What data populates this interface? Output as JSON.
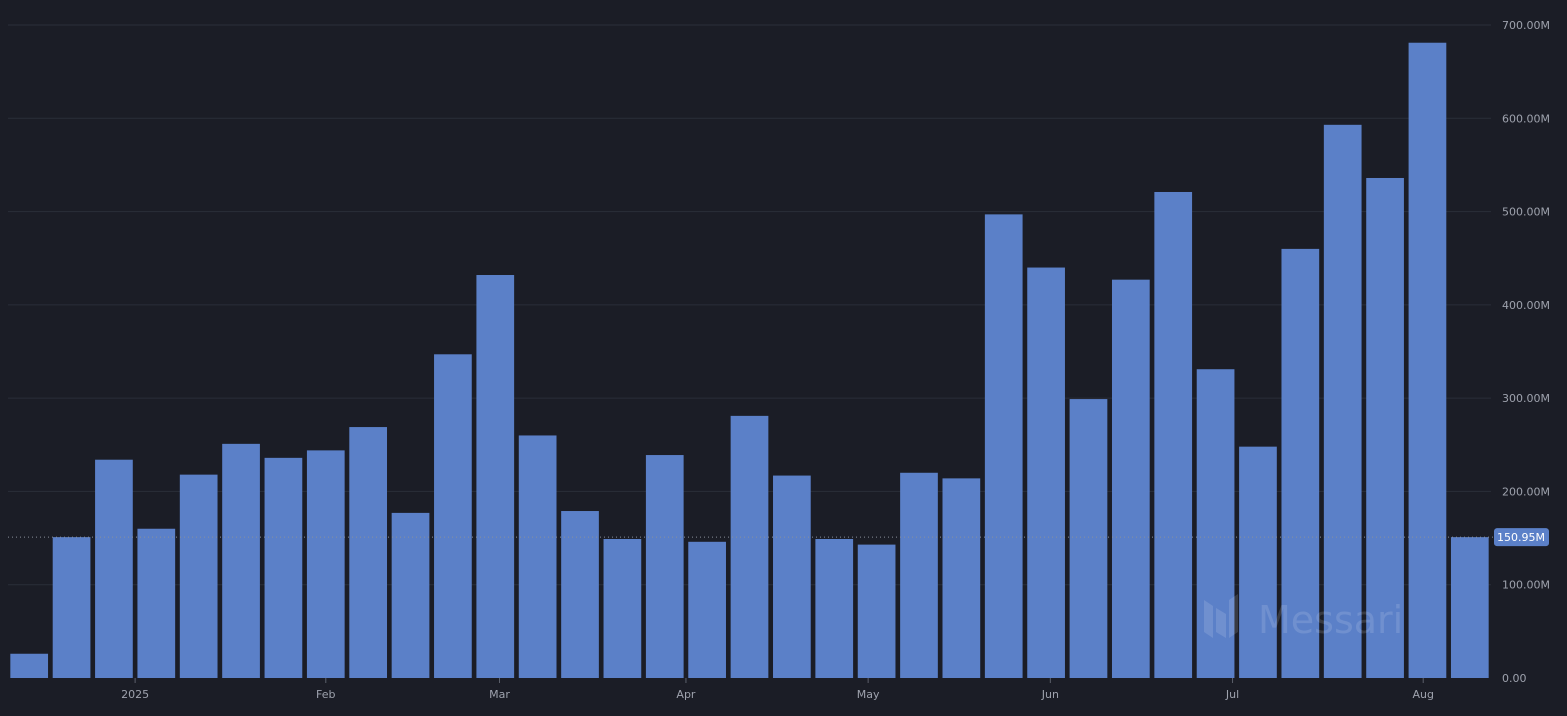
{
  "watermark": {
    "text": "Messari",
    "icon": "messari-logo-icon"
  },
  "current_value": {
    "value": 150.95,
    "label": "150.95M"
  },
  "chart_data": {
    "type": "bar",
    "title": "",
    "xlabel": "",
    "ylabel": "",
    "ylim": [
      0,
      700
    ],
    "grid": true,
    "y_ticks": [
      {
        "value": 0,
        "label": "0.00"
      },
      {
        "value": 100,
        "label": "100.00M"
      },
      {
        "value": 200,
        "label": "200.00M"
      },
      {
        "value": 300,
        "label": "300.00M"
      },
      {
        "value": 400,
        "label": "400.00M"
      },
      {
        "value": 500,
        "label": "500.00M"
      },
      {
        "value": 600,
        "label": "600.00M"
      },
      {
        "value": 700,
        "label": "700.00M"
      }
    ],
    "x_ticks": [
      {
        "label": "2025",
        "position": 3
      },
      {
        "label": "Feb",
        "position": 7.5
      },
      {
        "label": "Mar",
        "position": 11.6
      },
      {
        "label": "Apr",
        "position": 16
      },
      {
        "label": "May",
        "position": 20.3
      },
      {
        "label": "Jun",
        "position": 24.6
      },
      {
        "label": "Jul",
        "position": 28.9
      },
      {
        "label": "Aug",
        "position": 33.4
      }
    ],
    "values": [
      26,
      151,
      234,
      160,
      218,
      251,
      236,
      244,
      269,
      177,
      347,
      432,
      260,
      179,
      149,
      239,
      146,
      281,
      217,
      149,
      143,
      220,
      214,
      497,
      440,
      299,
      427,
      521,
      331,
      248,
      460,
      593,
      536,
      681,
      151
    ]
  }
}
